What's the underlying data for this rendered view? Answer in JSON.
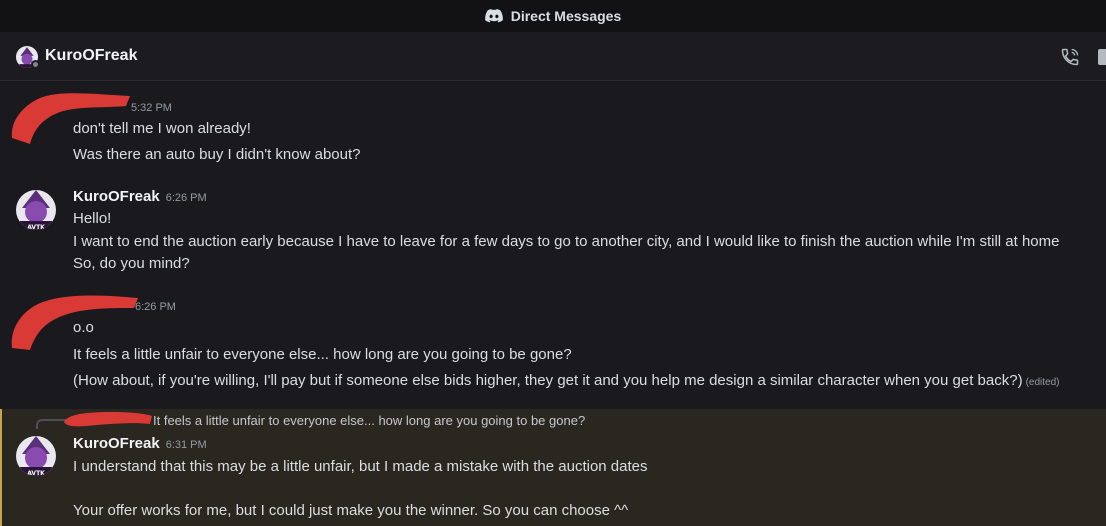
{
  "window": {
    "title": "Direct Messages"
  },
  "header": {
    "username": "KuroOFreak"
  },
  "messages": [
    {
      "time": "5:32 PM",
      "lines": [
        "don't tell me I won already!",
        "Was there an auto buy I didn't know about?"
      ]
    },
    {
      "author": "KuroOFreak",
      "time": "6:26 PM",
      "lines": [
        "Hello!",
        "I want to end the auction early because I have to leave for a few days to go to another city, and I would like to finish the auction while I'm still at home",
        "So, do you mind?"
      ]
    },
    {
      "time": "6:26 PM",
      "lines": [
        "o.o",
        "It feels a little unfair to everyone else... how long are you going to be gone?",
        "(How about, if you're willing, I'll pay but if someone else bids higher, they get it and you help me design a similar character when you get back?)"
      ],
      "edited": "(edited)"
    },
    {
      "reply_to": "It feels a little unfair to everyone else... how long are you going to be gone?",
      "author": "KuroOFreak",
      "time": "6:31 PM",
      "lines": [
        "I understand that this may be a little unfair, but I made a mistake with the auction dates",
        "Your offer works for me, but I could just make you the winner. So you can choose ^^"
      ]
    }
  ],
  "colors": {
    "background": "#1a1a1e",
    "highlight": "#2a2620",
    "highlight_border": "#c9a24a",
    "redaction": "#d93a35",
    "avatar_purple": "#5b2f7a"
  },
  "icons": [
    "discord-icon",
    "call-icon",
    "video-icon"
  ]
}
